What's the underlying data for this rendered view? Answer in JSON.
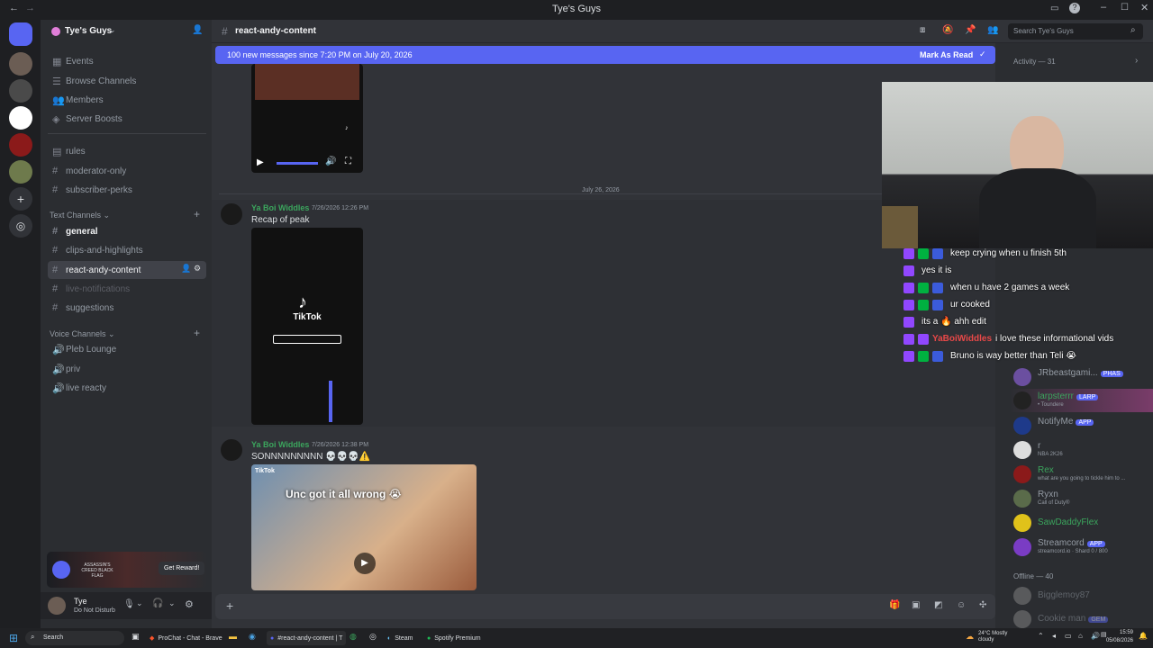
{
  "window": {
    "title": "Tye's Guys"
  },
  "guild": {
    "name": "Tye's Guys"
  },
  "sidebar": {
    "top_items": [
      {
        "label": "Events",
        "icon": "calendar-icon"
      },
      {
        "label": "Browse Channels",
        "icon": "browse-icon"
      },
      {
        "label": "Members",
        "icon": "members-icon"
      },
      {
        "label": "Server Boosts",
        "icon": "boost-icon"
      }
    ],
    "channels_top": [
      {
        "label": "rules"
      },
      {
        "label": "moderator-only"
      },
      {
        "label": "subscriber-perks"
      }
    ],
    "text_category": "Text Channels",
    "text_channels": [
      {
        "label": "general"
      },
      {
        "label": "clips-and-highlights"
      },
      {
        "label": "react-andy-content"
      },
      {
        "label": "live-notifications"
      },
      {
        "label": "suggestions"
      }
    ],
    "voice_category": "Voice Channels",
    "voice_channels": [
      {
        "label": "Pleb Lounge"
      },
      {
        "label": "priv"
      },
      {
        "label": "live reacty"
      }
    ],
    "promo": {
      "game": "ASSASSIN'S CREED BLACK FLAG",
      "button": "Get Reward!"
    },
    "user": {
      "name": "Tye",
      "status": "Do Not Disturb"
    }
  },
  "channel": {
    "name": "react-andy-content",
    "new_messages_banner": "100 new messages since 7:20 PM on July 20, 2026",
    "mark_as_read": "Mark As Read",
    "date_divider": "July 26, 2026",
    "messages": [
      {
        "author": "Ya Boi Widdles",
        "time": "7/26/2026 12:26 PM",
        "text": "Recap of peak",
        "embed": "TikTok"
      },
      {
        "author": "Ya Boi Widdles",
        "time": "7/26/2026 12:38 PM",
        "text": "SONNNNNNNNN 💀💀💀⚠️",
        "embed_caption": "Unc got it all wrong 😭",
        "embed_brand": "TikTok"
      }
    ]
  },
  "search": {
    "placeholder": "Search Tye's Guys"
  },
  "members_panel": {
    "activity": "Activity — 31",
    "offline": "Offline — 40",
    "members": [
      {
        "name": "JRbeastgami...",
        "sub": "",
        "tag": "PHAS",
        "color": "#949ba4"
      },
      {
        "name": "larpsterrr",
        "sub": "• Toundere",
        "tag": "LARP",
        "color": "#3ba55d"
      },
      {
        "name": "NotifyMe",
        "sub": "",
        "tag": "APP",
        "color": "#949ba4"
      },
      {
        "name": "r",
        "sub": "NBA 2K26",
        "tag": "",
        "color": "#949ba4"
      },
      {
        "name": "Rex",
        "sub": "what are you going to tickle him to ...",
        "tag": "",
        "color": "#3ba55d"
      },
      {
        "name": "Ryxn",
        "sub": "Call of Duty®",
        "tag": "",
        "color": "#949ba4"
      },
      {
        "name": "SawDaddyFlex",
        "sub": "",
        "tag": "",
        "color": "#3ba55d"
      },
      {
        "name": "Streamcord",
        "sub": "streamcord.io · Shard 0 / 800",
        "tag": "APP",
        "color": "#949ba4"
      },
      {
        "name": "Bigglemoy87",
        "sub": "",
        "tag": "",
        "color": "#5c5e66"
      },
      {
        "name": "Cookie man",
        "sub": "",
        "tag": "GEM",
        "color": "#5c5e66"
      }
    ]
  },
  "stream_chat": [
    {
      "user": "",
      "text": "keep crying when u finish 5th",
      "color": "#3b5bdb"
    },
    {
      "user": "",
      "text": "yes it is",
      "color": "#d42f2f"
    },
    {
      "user": "",
      "text": "when u have 2 games a week",
      "color": "#3b5bdb"
    },
    {
      "user": "",
      "text": "ur cooked",
      "color": "#3b5bdb"
    },
    {
      "user": "",
      "text": "its a 🔥 ahh edit",
      "color": "#d42f2f"
    },
    {
      "user": "YaBoiWiddles",
      "text": "i love these informational vids",
      "color": "#e84848"
    },
    {
      "user": "",
      "text": "Bruno is way better than Teli 😭",
      "color": "#3b5bdb"
    }
  ],
  "taskbar": {
    "search": "Search",
    "apps": [
      "ProChat - Chat - Brave",
      "#react-andy-content | T",
      "Steam",
      "Spotify Premium"
    ],
    "weather": "24°C Mostly cloudy",
    "time": "15:59",
    "date": "05/08/2026"
  },
  "colors": {
    "accent": "#5865f2",
    "online": "#3ba55d",
    "bg": "#313338"
  }
}
